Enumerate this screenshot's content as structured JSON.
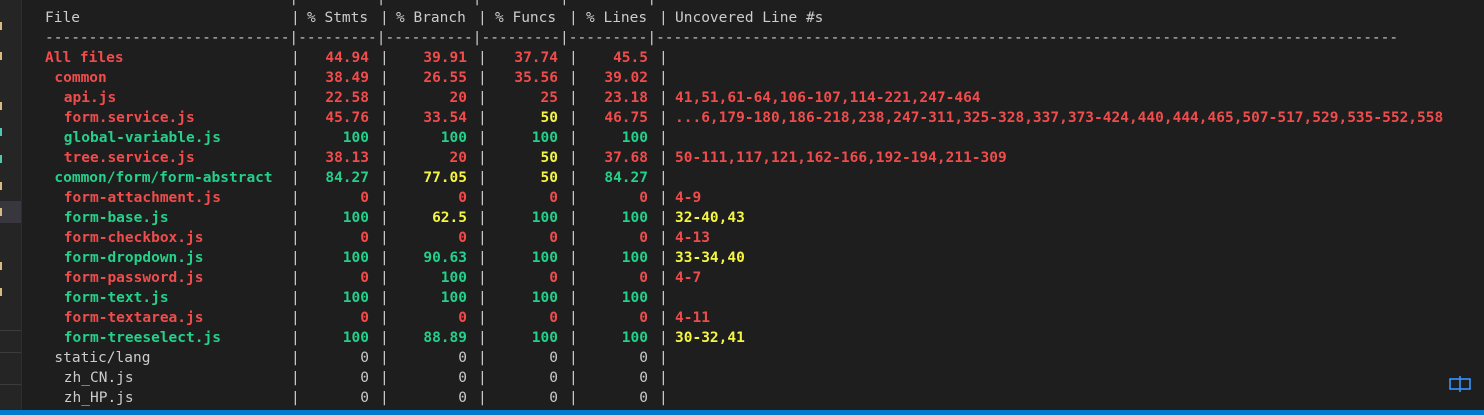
{
  "colors": {
    "red": "#f14c4c",
    "green": "#23d18b",
    "yellow": "#f5f543",
    "plain": "#cccccc",
    "accent": "#007acc"
  },
  "table": {
    "headers": [
      "File",
      "% Stmts",
      "% Branch",
      "% Funcs",
      "% Lines",
      "Uncovered Line #s"
    ],
    "separator": "----------------------------|---------|----------|---------|---------|-------------------------------------------------------------------------------------",
    "rows": [
      {
        "file": "All files",
        "indent": 0,
        "fileColor": "red",
        "stmts": "44.94",
        "stmtsColor": "red",
        "branch": "39.91",
        "branchColor": "red",
        "funcs": "37.74",
        "funcsColor": "red",
        "lines": "45.5",
        "linesColor": "red",
        "uncovered": "",
        "uncoveredColor": "red"
      },
      {
        "file": "common",
        "indent": 1,
        "fileColor": "red",
        "stmts": "38.49",
        "stmtsColor": "red",
        "branch": "26.55",
        "branchColor": "red",
        "funcs": "35.56",
        "funcsColor": "red",
        "lines": "39.02",
        "linesColor": "red",
        "uncovered": "",
        "uncoveredColor": "red"
      },
      {
        "file": "api.js",
        "indent": 2,
        "fileColor": "red",
        "stmts": "22.58",
        "stmtsColor": "red",
        "branch": "20",
        "branchColor": "red",
        "funcs": "25",
        "funcsColor": "red",
        "lines": "23.18",
        "linesColor": "red",
        "uncovered": "41,51,61-64,106-107,114-221,247-464",
        "uncoveredColor": "red"
      },
      {
        "file": "form.service.js",
        "indent": 2,
        "fileColor": "red",
        "stmts": "45.76",
        "stmtsColor": "red",
        "branch": "33.54",
        "branchColor": "red",
        "funcs": "50",
        "funcsColor": "yellow",
        "lines": "46.75",
        "linesColor": "red",
        "uncovered": "...6,179-180,186-218,238,247-311,325-328,337,373-424,440,444,465,507-517,529,535-552,558",
        "uncoveredColor": "red"
      },
      {
        "file": "global-variable.js",
        "indent": 2,
        "fileColor": "green",
        "stmts": "100",
        "stmtsColor": "green",
        "branch": "100",
        "branchColor": "green",
        "funcs": "100",
        "funcsColor": "green",
        "lines": "100",
        "linesColor": "green",
        "uncovered": "",
        "uncoveredColor": "green"
      },
      {
        "file": "tree.service.js",
        "indent": 2,
        "fileColor": "red",
        "stmts": "38.13",
        "stmtsColor": "red",
        "branch": "20",
        "branchColor": "red",
        "funcs": "50",
        "funcsColor": "yellow",
        "lines": "37.68",
        "linesColor": "red",
        "uncovered": "50-111,117,121,162-166,192-194,211-309",
        "uncoveredColor": "red"
      },
      {
        "file": "common/form/form-abstract",
        "indent": 1,
        "fileColor": "green",
        "stmts": "84.27",
        "stmtsColor": "green",
        "branch": "77.05",
        "branchColor": "yellow",
        "funcs": "50",
        "funcsColor": "yellow",
        "lines": "84.27",
        "linesColor": "green",
        "uncovered": "",
        "uncoveredColor": "green"
      },
      {
        "file": "form-attachment.js",
        "indent": 2,
        "fileColor": "red",
        "stmts": "0",
        "stmtsColor": "red",
        "branch": "0",
        "branchColor": "red",
        "funcs": "0",
        "funcsColor": "red",
        "lines": "0",
        "linesColor": "red",
        "uncovered": "4-9",
        "uncoveredColor": "red"
      },
      {
        "file": "form-base.js",
        "indent": 2,
        "fileColor": "green",
        "stmts": "100",
        "stmtsColor": "green",
        "branch": "62.5",
        "branchColor": "yellow",
        "funcs": "100",
        "funcsColor": "green",
        "lines": "100",
        "linesColor": "green",
        "uncovered": "32-40,43",
        "uncoveredColor": "yellow"
      },
      {
        "file": "form-checkbox.js",
        "indent": 2,
        "fileColor": "red",
        "stmts": "0",
        "stmtsColor": "red",
        "branch": "0",
        "branchColor": "red",
        "funcs": "0",
        "funcsColor": "red",
        "lines": "0",
        "linesColor": "red",
        "uncovered": "4-13",
        "uncoveredColor": "red"
      },
      {
        "file": "form-dropdown.js",
        "indent": 2,
        "fileColor": "green",
        "stmts": "100",
        "stmtsColor": "green",
        "branch": "90.63",
        "branchColor": "green",
        "funcs": "100",
        "funcsColor": "green",
        "lines": "100",
        "linesColor": "green",
        "uncovered": "33-34,40",
        "uncoveredColor": "yellow"
      },
      {
        "file": "form-password.js",
        "indent": 2,
        "fileColor": "red",
        "stmts": "0",
        "stmtsColor": "red",
        "branch": "100",
        "branchColor": "green",
        "funcs": "0",
        "funcsColor": "red",
        "lines": "0",
        "linesColor": "red",
        "uncovered": "4-7",
        "uncoveredColor": "red"
      },
      {
        "file": "form-text.js",
        "indent": 2,
        "fileColor": "green",
        "stmts": "100",
        "stmtsColor": "green",
        "branch": "100",
        "branchColor": "green",
        "funcs": "100",
        "funcsColor": "green",
        "lines": "100",
        "linesColor": "green",
        "uncovered": "",
        "uncoveredColor": "green"
      },
      {
        "file": "form-textarea.js",
        "indent": 2,
        "fileColor": "red",
        "stmts": "0",
        "stmtsColor": "red",
        "branch": "0",
        "branchColor": "red",
        "funcs": "0",
        "funcsColor": "red",
        "lines": "0",
        "linesColor": "red",
        "uncovered": "4-11",
        "uncoveredColor": "red"
      },
      {
        "file": "form-treeselect.js",
        "indent": 2,
        "fileColor": "green",
        "stmts": "100",
        "stmtsColor": "green",
        "branch": "88.89",
        "branchColor": "green",
        "funcs": "100",
        "funcsColor": "green",
        "lines": "100",
        "linesColor": "green",
        "uncovered": "30-32,41",
        "uncoveredColor": "yellow"
      },
      {
        "file": "static/lang",
        "indent": 1,
        "fileColor": "plain",
        "stmts": "0",
        "stmtsColor": "plain",
        "branch": "0",
        "branchColor": "plain",
        "funcs": "0",
        "funcsColor": "plain",
        "lines": "0",
        "linesColor": "plain",
        "uncovered": "",
        "uncoveredColor": "plain"
      },
      {
        "file": "zh_CN.js",
        "indent": 2,
        "fileColor": "plain",
        "stmts": "0",
        "stmtsColor": "plain",
        "branch": "0",
        "branchColor": "plain",
        "funcs": "0",
        "funcsColor": "plain",
        "lines": "0",
        "linesColor": "plain",
        "uncovered": "",
        "uncoveredColor": "plain"
      },
      {
        "file": "zh_HP.js",
        "indent": 2,
        "fileColor": "plain",
        "stmts": "0",
        "stmtsColor": "plain",
        "branch": "0",
        "branchColor": "plain",
        "funcs": "0",
        "funcsColor": "plain",
        "lines": "0",
        "linesColor": "plain",
        "uncovered": "",
        "uncoveredColor": "plain"
      }
    ]
  },
  "icons": {
    "corner": "split-terminal-icon"
  }
}
